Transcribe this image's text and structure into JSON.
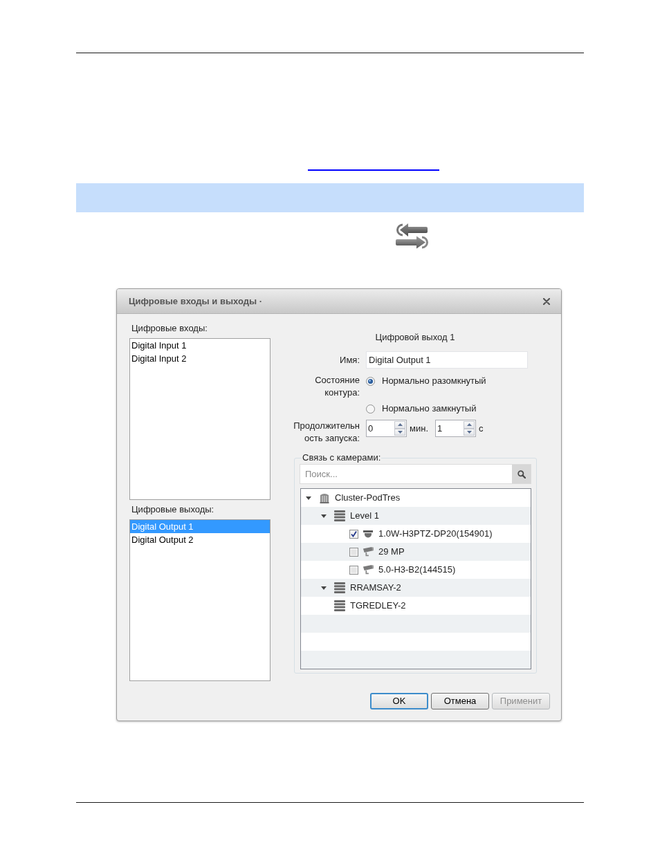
{
  "dialog": {
    "title": "Цифровые входы и выходы ·",
    "inputs": {
      "label": "Цифровые входы:",
      "items": [
        {
          "label": "Digital Input 1",
          "selected": false
        },
        {
          "label": "Digital Input 2",
          "selected": false
        }
      ]
    },
    "outputs": {
      "label": "Цифровые выходы:",
      "items": [
        {
          "label": "Digital Output 1",
          "selected": true
        },
        {
          "label": "Digital Output 2",
          "selected": false
        }
      ]
    },
    "details": {
      "heading": "Цифровой выход 1",
      "name": {
        "label": "Имя:",
        "value": "Digital Output 1"
      },
      "contact_state": {
        "label": "Состояние\nконтура:",
        "options": [
          {
            "label": "Нормально разомкнутый",
            "selected": true
          },
          {
            "label": "Нормально замкнутый",
            "selected": false
          }
        ]
      },
      "duration": {
        "label": "Продолжительн\nость запуска:",
        "fields": [
          {
            "value": "0",
            "unit": "мин."
          },
          {
            "value": "1",
            "unit": "с"
          }
        ]
      }
    },
    "cameras": {
      "legend": "Связь с камерами:",
      "search": {
        "placeholder": "Поиск..."
      },
      "tree": [
        {
          "label": "Cluster-PodTres",
          "kind": "cluster",
          "expanded": true,
          "children": [
            {
              "label": "Level 1",
              "kind": "server",
              "expanded": true,
              "children": [
                {
                  "label": "1.0W-H3PTZ-DP20(154901)",
                  "kind": "dome_camera",
                  "checked": true
                },
                {
                  "label": "29 MP",
                  "kind": "box_camera",
                  "checked": false
                },
                {
                  "label": "5.0-H3-B2(144515)",
                  "kind": "box_camera",
                  "checked": false
                }
              ]
            },
            {
              "label": "RRAMSAY-2",
              "kind": "server",
              "expanded": true
            },
            {
              "label": "TGREDLEY-2",
              "kind": "server"
            }
          ]
        }
      ]
    },
    "buttons": [
      {
        "label": "OK",
        "kind": "default",
        "disabled": false
      },
      {
        "label": "Отмена",
        "kind": "normal",
        "disabled": false
      },
      {
        "label": "Применит",
        "kind": "normal",
        "disabled": true
      }
    ]
  }
}
